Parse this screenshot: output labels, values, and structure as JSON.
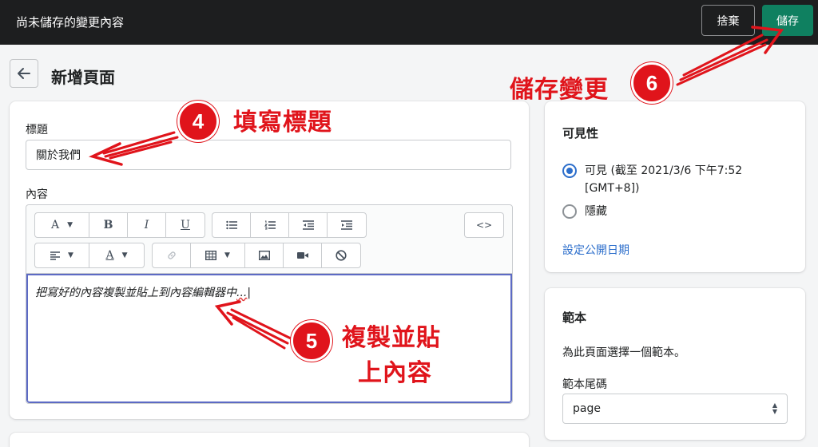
{
  "topbar": {
    "title": "尚未儲存的變更內容",
    "discard_label": "捨棄",
    "save_label": "儲存"
  },
  "page": {
    "title": "新增頁面"
  },
  "form": {
    "title_label": "標題",
    "title_value": "關於我們",
    "content_label": "內容",
    "content_text": "把寫好的內容複製並貼上到內容編輯器中",
    "content_squiggle": "..."
  },
  "toolbar": {
    "font_glyph": "A",
    "bold_glyph": "B",
    "italic_glyph": "I",
    "underline_glyph": "U",
    "code_glyph": "<>",
    "text_color_glyph": "A",
    "icons": [
      "font-format-icon",
      "bold-icon",
      "italic-icon",
      "underline-icon",
      "bullet-list-icon",
      "numbered-list-icon",
      "outdent-icon",
      "indent-icon",
      "html-code-icon",
      "align-icon",
      "text-color-icon",
      "link-icon",
      "table-icon",
      "image-icon",
      "video-icon",
      "clear-format-icon"
    ]
  },
  "visibility": {
    "heading": "可見性",
    "visible_label": "可見 (截至 2021/3/6 下午7:52",
    "visible_label_line2": "[GMT+8])",
    "hidden_label": "隱藏",
    "schedule_link": "設定公開日期"
  },
  "template": {
    "heading": "範本",
    "hint": "為此頁面選擇一個範本。",
    "suffix_label": "範本尾碼",
    "suffix_value": "page"
  },
  "annotations": {
    "step4_number": "4",
    "step4_text": "填寫標題",
    "step5_number": "5",
    "step5_text_line1": "複製並貼",
    "step5_text_line2": "上內容",
    "step6_number": "6",
    "step6_text": "儲存變更"
  },
  "colors": {
    "topbar": "#1d1e1f",
    "primary": "#0f8060",
    "link": "#2c6ecb",
    "annotation": "#e0141b"
  }
}
